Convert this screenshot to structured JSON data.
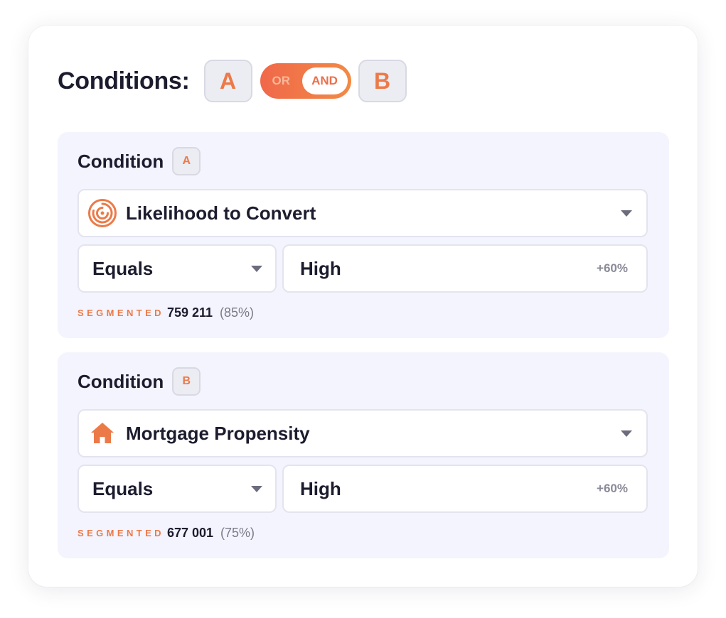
{
  "header": {
    "title": "Conditions:",
    "operand_a": "A",
    "operand_b": "B",
    "toggle": {
      "off_label": "OR",
      "on_label": "AND",
      "selected": "AND"
    }
  },
  "conditions": [
    {
      "title": "Condition",
      "badge": "A",
      "attribute": {
        "icon": "target-circle-icon",
        "label": "Likelihood to Convert"
      },
      "operator": "Equals",
      "value": {
        "label": "High",
        "modifier": "+60%"
      },
      "stats": {
        "label": "SEGMENTED",
        "count": "759 211",
        "percent": "(85%)"
      }
    },
    {
      "title": "Condition",
      "badge": "B",
      "attribute": {
        "icon": "house-icon",
        "label": "Mortgage Propensity"
      },
      "operator": "Equals",
      "value": {
        "label": "High",
        "modifier": "+60%"
      },
      "stats": {
        "label": "SEGMENTED",
        "count": "677 001",
        "percent": "(75%)"
      }
    }
  ],
  "colors": {
    "accent": "#ec7a48",
    "toggle_gradient_start": "#f0684a",
    "toggle_gradient_end": "#f28a45",
    "panel_bg": "#f3f4fd",
    "text_dark": "#1c1c2e",
    "text_muted": "#8a8a98"
  }
}
